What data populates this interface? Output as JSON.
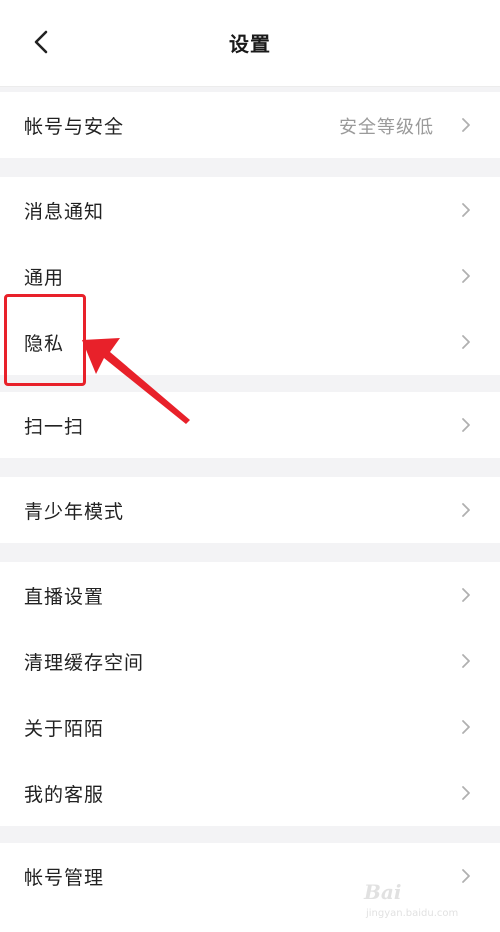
{
  "header": {
    "title": "设置",
    "back_icon": "back-arrow-icon"
  },
  "settings": {
    "items": [
      {
        "label": "帐号与安全",
        "value": "安全等级低"
      },
      {
        "label": "消息通知"
      },
      {
        "label": "通用"
      },
      {
        "label": "隐私"
      },
      {
        "label": "扫一扫"
      },
      {
        "label": "青少年模式"
      },
      {
        "label": "直播设置"
      },
      {
        "label": "清理缓存空间"
      },
      {
        "label": "关于陌陌"
      },
      {
        "label": "我的客服"
      },
      {
        "label": "帐号管理"
      }
    ]
  },
  "annotation": {
    "highlight_color": "#e8212a"
  },
  "watermark": {
    "logo": "Bai",
    "url": "jingyan.baidu.com"
  }
}
